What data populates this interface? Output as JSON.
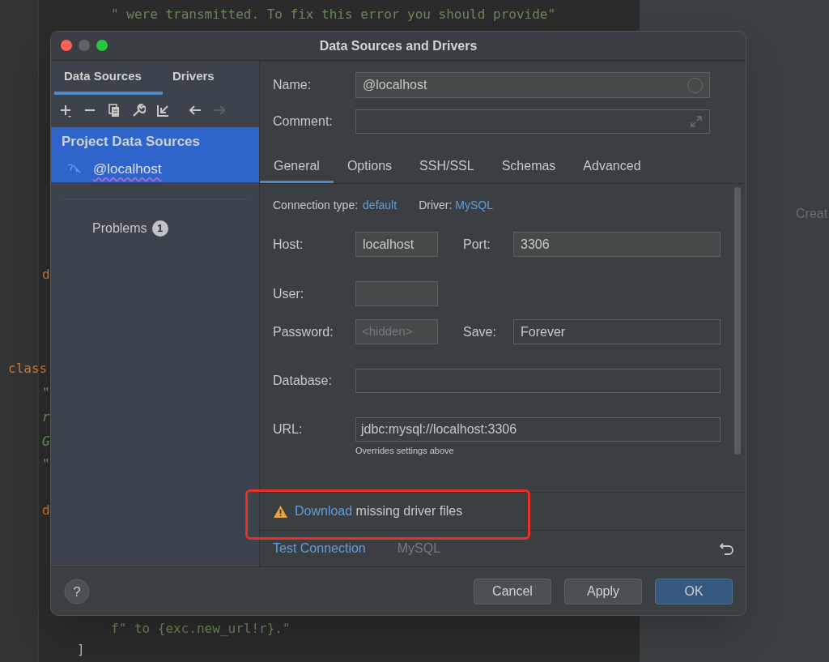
{
  "editor": {
    "lines": [
      {
        "text": "\" were transmitted. To fix this error you should provide\"",
        "kind": "string"
      },
      {
        "text": "d",
        "kind": "keyword"
      },
      {
        "text": "class",
        "kind": "keyword"
      },
      {
        "text": "\"",
        "kind": "docstring"
      },
      {
        "text": "r",
        "kind": "docstring"
      },
      {
        "text": "G",
        "kind": "docstring"
      },
      {
        "text": "\"",
        "kind": "docstring"
      },
      {
        "text": "d",
        "kind": "keyword"
      },
      {
        "text": "f\" to {exc.new_url!r}.\"",
        "kind": "string"
      },
      {
        "text": "]",
        "kind": "plain"
      }
    ]
  },
  "side_panel": {
    "text": "Creat"
  },
  "dialog": {
    "title": "Data Sources and Drivers",
    "left_tabs": [
      {
        "label": "Data Sources",
        "selected": true
      },
      {
        "label": "Drivers",
        "selected": false
      }
    ],
    "toolbar": [
      {
        "kind": "add",
        "disabled": false
      },
      {
        "kind": "remove",
        "disabled": false
      },
      {
        "kind": "copy",
        "disabled": false
      },
      {
        "kind": "wrench",
        "disabled": false
      },
      {
        "kind": "import",
        "disabled": false
      },
      {
        "kind": "back",
        "disabled": false
      },
      {
        "kind": "forward",
        "disabled": true
      }
    ],
    "tree": [
      {
        "label": "Project Data Sources",
        "selected": true,
        "children": [
          {
            "label": "@localhost",
            "selected": true
          }
        ]
      }
    ],
    "problems": {
      "label": "Problems",
      "count": "1"
    },
    "name": {
      "label": "Name:",
      "value": "@localhost"
    },
    "comment": {
      "label": "Comment:"
    },
    "tabs": [
      {
        "label": "General",
        "selected": true
      },
      {
        "label": "Options",
        "selected": false
      },
      {
        "label": "SSH/SSL",
        "selected": false
      },
      {
        "label": "Schemas",
        "selected": false
      },
      {
        "label": "Advanced",
        "selected": false
      }
    ],
    "connection_type": {
      "label": "Connection type:",
      "value": "default"
    },
    "driver": {
      "label": "Driver:",
      "value": "MySQL"
    },
    "host": {
      "label": "Host:",
      "value": "localhost"
    },
    "port": {
      "label": "Port:",
      "value": "3306"
    },
    "user": {
      "label": "User:"
    },
    "password": {
      "label": "Password:",
      "placeholder": "<hidden>"
    },
    "save": {
      "label": "Save:",
      "value": "Forever"
    },
    "database": {
      "label": "Database:"
    },
    "url": {
      "label": "URL:",
      "value": "jdbc:mysql://localhost:3306",
      "hint": "Overrides settings above"
    },
    "warning": {
      "link": "Download",
      "text": "missing driver files"
    },
    "test_connection": "Test Connection",
    "driver_name": "MySQL",
    "help": "?",
    "buttons": [
      {
        "label": "Cancel",
        "primary": false
      },
      {
        "label": "Apply",
        "primary": false
      },
      {
        "label": "OK",
        "primary": true
      }
    ]
  }
}
